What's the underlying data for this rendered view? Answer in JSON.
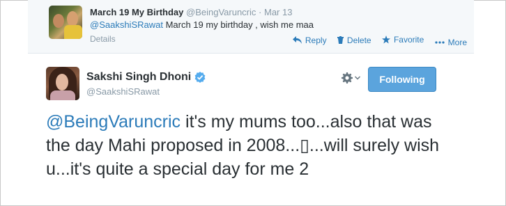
{
  "parent_tweet": {
    "name": "March 19 My Birthday",
    "handle": "@BeingVaruncric",
    "separator": "·",
    "date": "Mar 13",
    "mention": "@SaakshiSRawat",
    "text": " March 19 my birthday , wish me maa",
    "details_label": "Details",
    "actions": {
      "reply": "Reply",
      "delete": "Delete",
      "favorite": "Favorite",
      "more": "More"
    }
  },
  "main_tweet": {
    "name": "Sakshi Singh Dhoni",
    "handle": "@SaakshiSRawat",
    "follow_label": "Following",
    "mention": "@BeingVaruncric",
    "text": " it's my mums too...also that was the day Mahi proposed in 2008...▯...will surely wish u...it's quite a special day for me 2"
  },
  "colors": {
    "link": "#2b7bb9",
    "muted": "#8899a6",
    "button_blue": "#5ba4dd",
    "parent_bg": "#f5f8fa"
  },
  "icons": {
    "reply": "reply-icon",
    "delete": "trash-icon",
    "favorite": "star-icon",
    "more": "more-dots-icon",
    "verified": "verified-badge-icon",
    "settings": "gear-icon"
  }
}
